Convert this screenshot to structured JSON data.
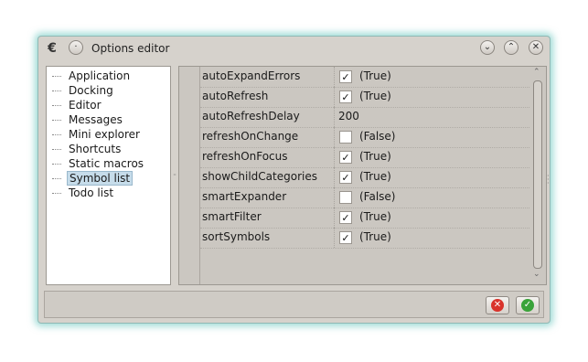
{
  "window": {
    "title": "Options editor",
    "app_icon": "app-logo-icon",
    "buttons": {
      "minimize": "chevron-down-icon",
      "maximize": "chevron-up-icon",
      "close": "close-icon"
    }
  },
  "tree": {
    "items": [
      {
        "label": "Application",
        "selected": false
      },
      {
        "label": "Docking",
        "selected": false
      },
      {
        "label": "Editor",
        "selected": false
      },
      {
        "label": "Messages",
        "selected": false
      },
      {
        "label": "Mini explorer",
        "selected": false
      },
      {
        "label": "Shortcuts",
        "selected": false
      },
      {
        "label": "Static macros",
        "selected": false
      },
      {
        "label": "Symbol list",
        "selected": true
      },
      {
        "label": "Todo list",
        "selected": false
      }
    ]
  },
  "properties": [
    {
      "name": "autoExpandErrors",
      "type": "bool",
      "checked": true,
      "value": "(True)"
    },
    {
      "name": "autoRefresh",
      "type": "bool",
      "checked": true,
      "value": "(True)"
    },
    {
      "name": "autoRefreshDelay",
      "type": "int",
      "value": "200"
    },
    {
      "name": "refreshOnChange",
      "type": "bool",
      "checked": false,
      "value": "(False)"
    },
    {
      "name": "refreshOnFocus",
      "type": "bool",
      "checked": true,
      "value": "(True)"
    },
    {
      "name": "showChildCategories",
      "type": "bool",
      "checked": true,
      "value": "(True)"
    },
    {
      "name": "smartExpander",
      "type": "bool",
      "checked": false,
      "value": "(False)"
    },
    {
      "name": "smartFilter",
      "type": "bool",
      "checked": true,
      "value": "(True)"
    },
    {
      "name": "sortSymbols",
      "type": "bool",
      "checked": true,
      "value": "(True)"
    }
  ],
  "actions": {
    "cancel_icon": "cancel-icon",
    "ok_icon": "accept-icon",
    "cancel_color": "#d9332b",
    "ok_color": "#3aa33a"
  }
}
